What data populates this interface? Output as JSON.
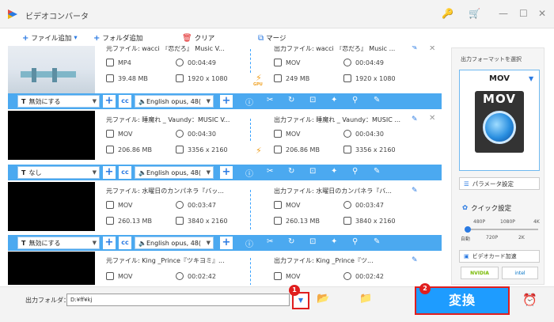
{
  "window": {
    "title": "ビデオコンバータ",
    "key_icon": "🔑",
    "cart_icon": "🛒",
    "min": "—",
    "max": "☐",
    "close": "✕"
  },
  "toolbar": {
    "add_file": "ファイル追加",
    "add_folder": "フォルダ追加",
    "clear": "クリア",
    "merge": "マージ",
    "dropdown": "▾"
  },
  "icons": {
    "plus": "+",
    "cc": "cc",
    "audio": "🔈",
    "info": "ⓘ",
    "cut": "✂",
    "rotate": "↻",
    "crop": "⊡",
    "effect": "✦",
    "watermark": "⚲",
    "edit": "✎",
    "pencil": "✎",
    "close": "✕",
    "gpu": "⚡",
    "gpu_label": "GPU",
    "file": "▣",
    "clock": "◷",
    "size": "▤",
    "res": "⛶"
  },
  "files": [
    {
      "src_title": "元ファイル: wacci 『恋だろ』 Music V...",
      "out_title": "出力ファイル: wacci 『恋だろ』 Music ...",
      "src_format": "MP4",
      "src_duration": "00:04:49",
      "src_size": "39.48 MB",
      "src_res": "1920 x 1080",
      "out_format": "MOV",
      "out_duration": "00:04:49",
      "out_size": "249 MB",
      "out_res": "1920 x 1080",
      "subtitle": "無効にする",
      "audio": "English opus, 48("
    },
    {
      "src_title": "元ファイル: 睡魔れ _ Vaundy：MUSIC V...",
      "out_title": "出力ファイル: 睡魔れ _ Vaundy：MUSIC ...",
      "src_format": "MOV",
      "src_duration": "00:04:30",
      "src_size": "206.86 MB",
      "src_res": "3356 x 2160",
      "out_format": "MOV",
      "out_duration": "00:04:30",
      "out_size": "206.86 MB",
      "out_res": "3356 x 2160",
      "subtitle": "なし",
      "audio": "English opus, 48("
    },
    {
      "src_title": "元ファイル: 水曜日のカンパネラ『バッ...",
      "out_title": "出力ファイル: 水曜日のカンパネラ『バ...",
      "src_format": "MOV",
      "src_duration": "00:03:47",
      "src_size": "260.13 MB",
      "src_res": "3840 x 2160",
      "out_format": "MOV",
      "out_duration": "00:03:47",
      "out_size": "260.13 MB",
      "out_res": "3840 x 2160",
      "subtitle": "無効にする",
      "audio": "English opus, 48("
    },
    {
      "src_title": "元ファイル: King _Prince『ツキヨミ』...",
      "out_title": "出力ファイル: King _Prince『ツ...",
      "src_format": "MOV",
      "src_duration": "00:02:42",
      "out_format": "MOV",
      "out_duration": "00:02:42"
    }
  ],
  "side": {
    "label": "出力フォーマットを選択",
    "format": "MOV",
    "format_arrow": "▼",
    "mov_icon_text": "MOV",
    "param_label": "パラメータ設定",
    "param_icon": "☰",
    "quick_label": "クイック設定",
    "quick_icon": "✿",
    "quick_top": [
      "480P",
      "1080P",
      "4K"
    ],
    "quick_bottom": [
      "自動",
      "720P",
      "2K"
    ],
    "quick_level": 0.0,
    "hw_label": "ビデオカード加速",
    "hw_icon": "▣",
    "nvidia": "NVIDIA",
    "intel": "intel"
  },
  "bottom": {
    "output_label": "出力フォルダ：",
    "output_path": "D:¥ff¥kj",
    "dropdown": "▼",
    "badge1": "1",
    "badge2": "2",
    "convert": "変換",
    "folder_icon": "📂",
    "open_icon": "📁",
    "alarm_icon": "⏰"
  },
  "colors": {
    "accent": "#2a7ae2",
    "bar": "#4ba9f0",
    "convert": "#1e9cff",
    "highlight": "#e01e1e"
  }
}
